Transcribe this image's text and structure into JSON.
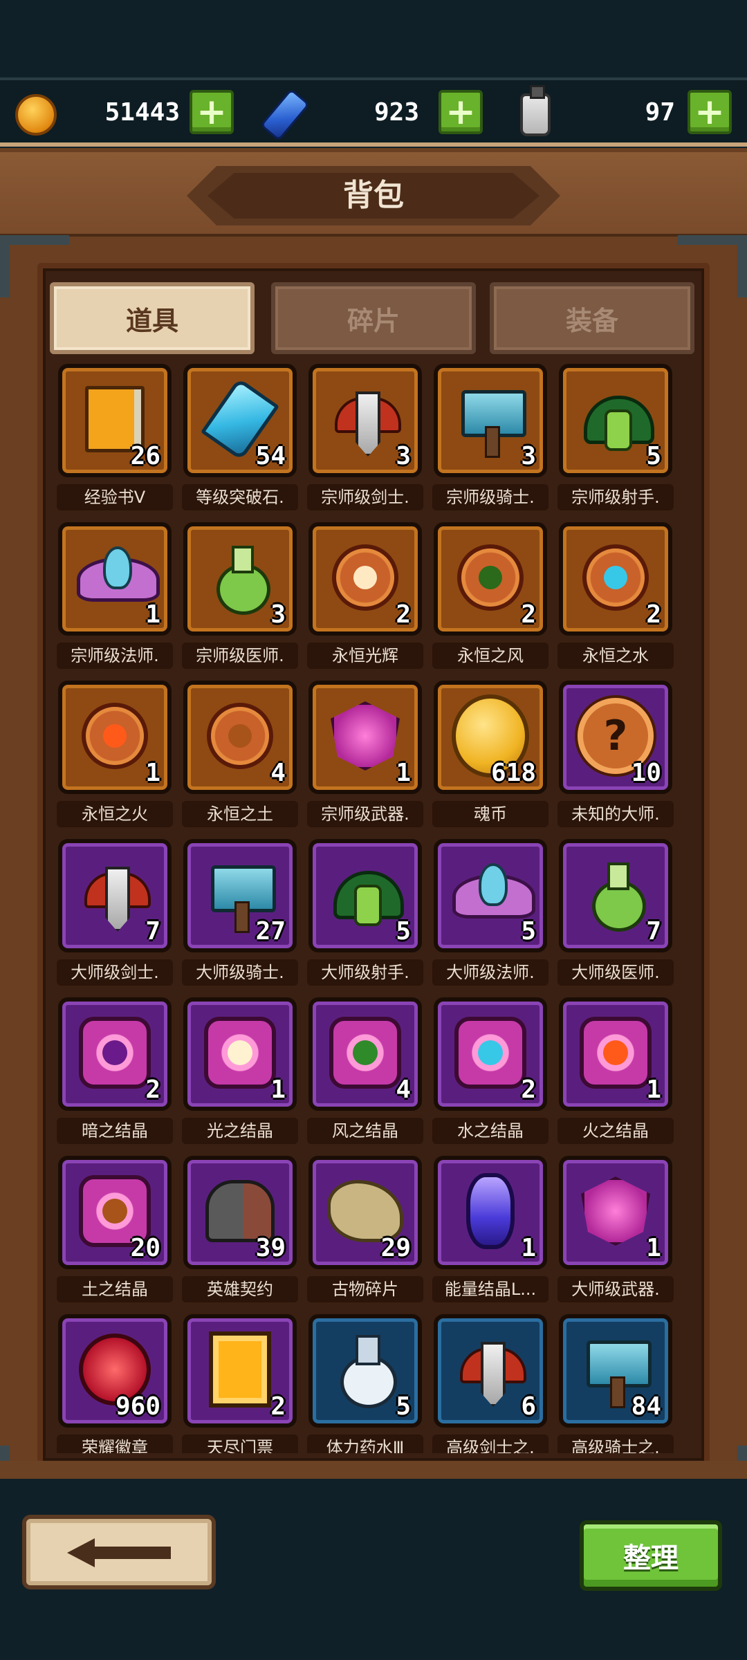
{
  "currencies": {
    "gold": {
      "icon": "gold-coin-icon",
      "value": "51443"
    },
    "gem": {
      "icon": "blue-gem-icon",
      "value": "923"
    },
    "potion": {
      "icon": "stamina-bottle-icon",
      "value": "97"
    },
    "plus_label": "+"
  },
  "header": {
    "title": "背包"
  },
  "tabs": [
    {
      "label": "道具",
      "active": true
    },
    {
      "label": "碎片",
      "active": false
    },
    {
      "label": "装备",
      "active": false
    }
  ],
  "items": [
    {
      "name": "经验书Ⅴ",
      "count": "26",
      "rarity": "orange",
      "icon": "exp-book-icon"
    },
    {
      "name": "等级突破石.",
      "count": "54",
      "rarity": "orange",
      "icon": "breakthrough-crystal-icon"
    },
    {
      "name": "宗师级剑士.",
      "count": "3",
      "rarity": "orange",
      "icon": "swordsman-emblem-icon"
    },
    {
      "name": "宗师级骑士.",
      "count": "3",
      "rarity": "orange",
      "icon": "knight-emblem-icon"
    },
    {
      "name": "宗师级射手.",
      "count": "5",
      "rarity": "orange",
      "icon": "archer-emblem-icon"
    },
    {
      "name": "宗师级法师.",
      "count": "1",
      "rarity": "orange",
      "icon": "mage-emblem-icon"
    },
    {
      "name": "宗师级医师.",
      "count": "3",
      "rarity": "orange",
      "icon": "healer-emblem-icon"
    },
    {
      "name": "永恒光辉",
      "count": "2",
      "rarity": "orange",
      "icon": "eternal-light-icon"
    },
    {
      "name": "永恒之风",
      "count": "2",
      "rarity": "orange",
      "icon": "eternal-wind-icon"
    },
    {
      "name": "永恒之水",
      "count": "2",
      "rarity": "orange",
      "icon": "eternal-water-icon"
    },
    {
      "name": "永恒之火",
      "count": "1",
      "rarity": "orange",
      "icon": "eternal-fire-icon"
    },
    {
      "name": "永恒之土",
      "count": "4",
      "rarity": "orange",
      "icon": "eternal-earth-icon"
    },
    {
      "name": "宗师级武器.",
      "count": "1",
      "rarity": "orange",
      "icon": "weapon-core-icon"
    },
    {
      "name": "魂币",
      "count": "618",
      "rarity": "orange",
      "icon": "soul-coin-icon"
    },
    {
      "name": "未知的大师.",
      "count": "10",
      "rarity": "purple",
      "icon": "mystery-medal-icon"
    },
    {
      "name": "大师级剑士.",
      "count": "7",
      "rarity": "purple",
      "icon": "swordsman-emblem-icon"
    },
    {
      "name": "大师级骑士.",
      "count": "27",
      "rarity": "purple",
      "icon": "knight-emblem-icon"
    },
    {
      "name": "大师级射手.",
      "count": "5",
      "rarity": "purple",
      "icon": "archer-emblem-icon"
    },
    {
      "name": "大师级法师.",
      "count": "5",
      "rarity": "purple",
      "icon": "mage-emblem-icon"
    },
    {
      "name": "大师级医师.",
      "count": "7",
      "rarity": "purple",
      "icon": "healer-emblem-icon"
    },
    {
      "name": "暗之结晶",
      "count": "2",
      "rarity": "purple",
      "icon": "dark-crystal-icon"
    },
    {
      "name": "光之结晶",
      "count": "1",
      "rarity": "purple",
      "icon": "light-crystal-icon"
    },
    {
      "name": "风之结晶",
      "count": "4",
      "rarity": "purple",
      "icon": "wind-crystal-icon"
    },
    {
      "name": "水之结晶",
      "count": "2",
      "rarity": "purple",
      "icon": "water-crystal-icon"
    },
    {
      "name": "火之结晶",
      "count": "1",
      "rarity": "purple",
      "icon": "fire-crystal-icon"
    },
    {
      "name": "土之结晶",
      "count": "20",
      "rarity": "purple",
      "icon": "earth-crystal-icon"
    },
    {
      "name": "英雄契约",
      "count": "39",
      "rarity": "purple",
      "icon": "hero-contract-icon"
    },
    {
      "name": "古物碎片",
      "count": "29",
      "rarity": "purple",
      "icon": "relic-fragment-icon"
    },
    {
      "name": "能量结晶L...",
      "count": "1",
      "rarity": "purple",
      "icon": "energy-crystal-icon"
    },
    {
      "name": "大师级武器.",
      "count": "1",
      "rarity": "purple",
      "icon": "weapon-core-icon"
    },
    {
      "name": "荣耀徽章",
      "count": "960",
      "rarity": "purple",
      "icon": "glory-badge-icon"
    },
    {
      "name": "天尽门票",
      "count": "2",
      "rarity": "purple",
      "icon": "ticket-icon"
    },
    {
      "name": "体力药水Ⅲ",
      "count": "5",
      "rarity": "blue",
      "icon": "stamina-potion-icon"
    },
    {
      "name": "高级剑士之.",
      "count": "6",
      "rarity": "blue",
      "icon": "swordsman-emblem-icon"
    },
    {
      "name": "高级骑士之.",
      "count": "84",
      "rarity": "blue",
      "icon": "knight-emblem-icon"
    }
  ],
  "footer": {
    "sort_label": "整理",
    "back_icon": "back-arrow-icon"
  },
  "colors": {
    "orange_slot": "#8e4a12",
    "purple_slot": "#5a1f7e",
    "blue_slot": "#133e62",
    "sort_button": "#6fc43a",
    "plus_button": "#69b22b"
  }
}
